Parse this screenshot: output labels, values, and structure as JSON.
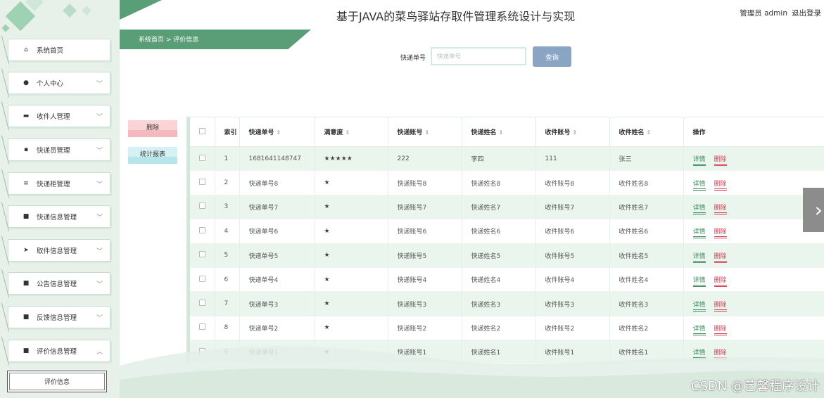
{
  "header": {
    "title": "基于JAVA的菜鸟驿站存取件管理系统设计与实现",
    "user_label": "管理员 admin",
    "logout": "退出登录"
  },
  "breadcrumb": {
    "text": "系统首页 > 评价信息"
  },
  "search": {
    "label": "快递单号",
    "placeholder": "快递单号",
    "value": "",
    "button": "查询"
  },
  "actions": {
    "delete": "删除",
    "stats": "统计报表"
  },
  "sidebar": {
    "items": [
      {
        "label": "系统首页",
        "icon": "home-icon"
      },
      {
        "label": "个人中心",
        "icon": "user-icon"
      },
      {
        "label": "收件人管理",
        "icon": "monitor-icon"
      },
      {
        "label": "快递员管理",
        "icon": "chat-icon"
      },
      {
        "label": "快递柜管理",
        "icon": "list-icon"
      },
      {
        "label": "快递信息管理",
        "icon": "grid-icon"
      },
      {
        "label": "取件信息管理",
        "icon": "send-icon"
      },
      {
        "label": "公告信息管理",
        "icon": "grid-icon"
      },
      {
        "label": "反馈信息管理",
        "icon": "grid-icon"
      },
      {
        "label": "评价信息管理",
        "icon": "grid-icon"
      }
    ],
    "sub_item": "评价信息"
  },
  "table": {
    "headers": [
      "索引",
      "快递单号",
      "满意度",
      "快递账号",
      "快递姓名",
      "收件账号",
      "收件姓名",
      "操作"
    ],
    "rows": [
      [
        "1",
        "1681641148747",
        "★★★★★",
        "222",
        "李四",
        "111",
        "张三"
      ],
      [
        "2",
        "快递单号8",
        "★",
        "快递账号8",
        "快递姓名8",
        "收件账号8",
        "收件姓名8"
      ],
      [
        "3",
        "快递单号7",
        "★",
        "快递账号7",
        "快递姓名7",
        "收件账号7",
        "收件姓名7"
      ],
      [
        "4",
        "快递单号6",
        "★",
        "快递账号6",
        "快递姓名6",
        "收件账号6",
        "收件姓名6"
      ],
      [
        "5",
        "快递单号5",
        "★",
        "快递账号5",
        "快递姓名5",
        "收件账号5",
        "收件姓名5"
      ],
      [
        "6",
        "快递单号4",
        "★",
        "快递账号4",
        "快递姓名4",
        "收件账号4",
        "收件姓名4"
      ],
      [
        "7",
        "快递单号3",
        "★",
        "快递账号3",
        "快递姓名3",
        "收件账号3",
        "收件姓名3"
      ],
      [
        "8",
        "快递单号2",
        "★",
        "快递账号2",
        "快递姓名2",
        "收件账号2",
        "收件姓名2"
      ],
      [
        "9",
        "快递单号1",
        "★",
        "快递账号1",
        "快递姓名1",
        "收件账号1",
        "收件姓名1"
      ]
    ],
    "op_detail": "详情",
    "op_delete": "删除"
  },
  "overlay": {
    "next_arrow": "›",
    "watermark": "CSDN @艺馨程序设计"
  },
  "colors": {
    "accent": "#5a9e77",
    "danger": "#d43f4f",
    "search_button": "#8aa5c4",
    "row_alt": "#eaf5ee"
  }
}
